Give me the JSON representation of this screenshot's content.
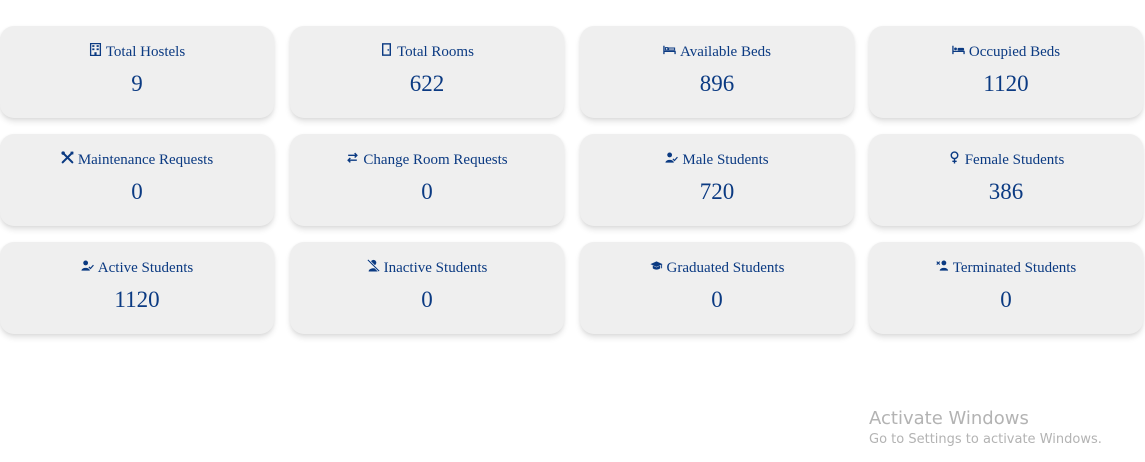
{
  "accent_color": "#0b3a82",
  "card_background": "#efefef",
  "cards": [
    {
      "label": "Total Hostels",
      "value": "9",
      "icon": "building-icon"
    },
    {
      "label": "Total Rooms",
      "value": "622",
      "icon": "door-icon"
    },
    {
      "label": "Available Beds",
      "value": "896",
      "icon": "bed-empty-icon"
    },
    {
      "label": "Occupied Beds",
      "value": "1120",
      "icon": "bed-icon"
    },
    {
      "label": "Maintenance Requests",
      "value": "0",
      "icon": "tools-icon"
    },
    {
      "label": "Change Room Requests",
      "value": "0",
      "icon": "swap-arrows-icon"
    },
    {
      "label": "Male Students",
      "value": "720",
      "icon": "user-check-icon"
    },
    {
      "label": "Female Students",
      "value": "386",
      "icon": "venus-icon"
    },
    {
      "label": "Active Students",
      "value": "1120",
      "icon": "user-check-icon"
    },
    {
      "label": "Inactive Students",
      "value": "0",
      "icon": "user-slash-icon"
    },
    {
      "label": "Graduated Students",
      "value": "0",
      "icon": "graduation-cap-icon"
    },
    {
      "label": "Terminated Students",
      "value": "0",
      "icon": "user-xmark-icon"
    }
  ],
  "watermark": {
    "title": "Activate Windows",
    "subtitle": "Go to Settings to activate Windows."
  }
}
